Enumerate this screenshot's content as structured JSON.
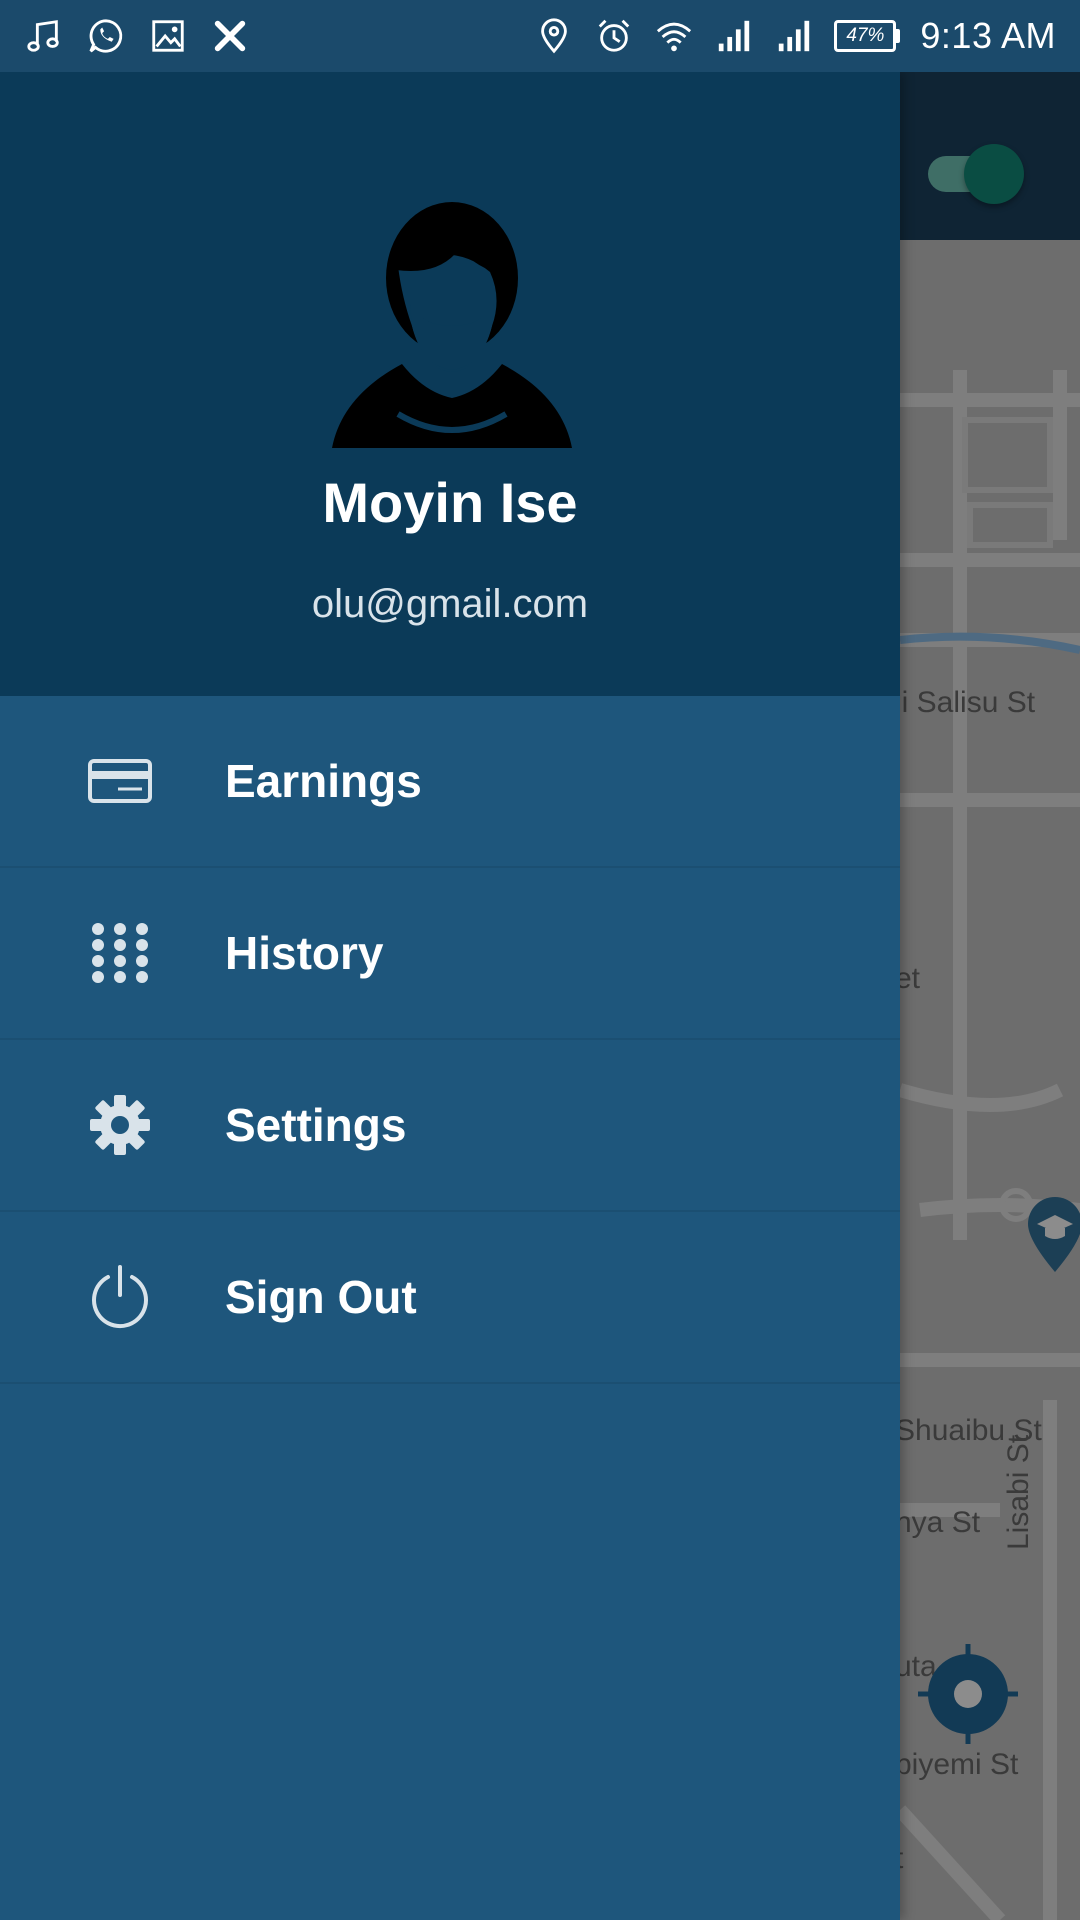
{
  "status_bar": {
    "left_icons": [
      "music-note-icon",
      "whatsapp-icon",
      "image-icon",
      "x-icon"
    ],
    "right_icons": [
      "location-pin-icon",
      "alarm-icon",
      "wifi-icon",
      "signal-icon",
      "signal-icon"
    ],
    "battery": "47%",
    "time": "9:13 AM"
  },
  "drawer": {
    "profile": {
      "name": "Moyin Ise",
      "email": "olu@gmail.com"
    },
    "menu": [
      {
        "label": "Earnings",
        "icon": "credit-card-icon"
      },
      {
        "label": "History",
        "icon": "grid-dots-icon"
      },
      {
        "label": "Settings",
        "icon": "gear-icon"
      },
      {
        "label": "Sign Out",
        "icon": "power-icon"
      }
    ]
  },
  "map": {
    "street_labels": [
      "ji Salisu St",
      "et",
      "Shuaibu St",
      "nya St",
      "Lisabi St",
      "uta",
      "biyemi St",
      "t"
    ],
    "toggle_on": true
  },
  "colors": {
    "status_bar": "#1b4a6b",
    "drawer_header": "#0b3a58",
    "drawer_body": "#1e567c",
    "map_dim": "#6d6d6d",
    "toggle_thumb": "#0a4d43"
  }
}
